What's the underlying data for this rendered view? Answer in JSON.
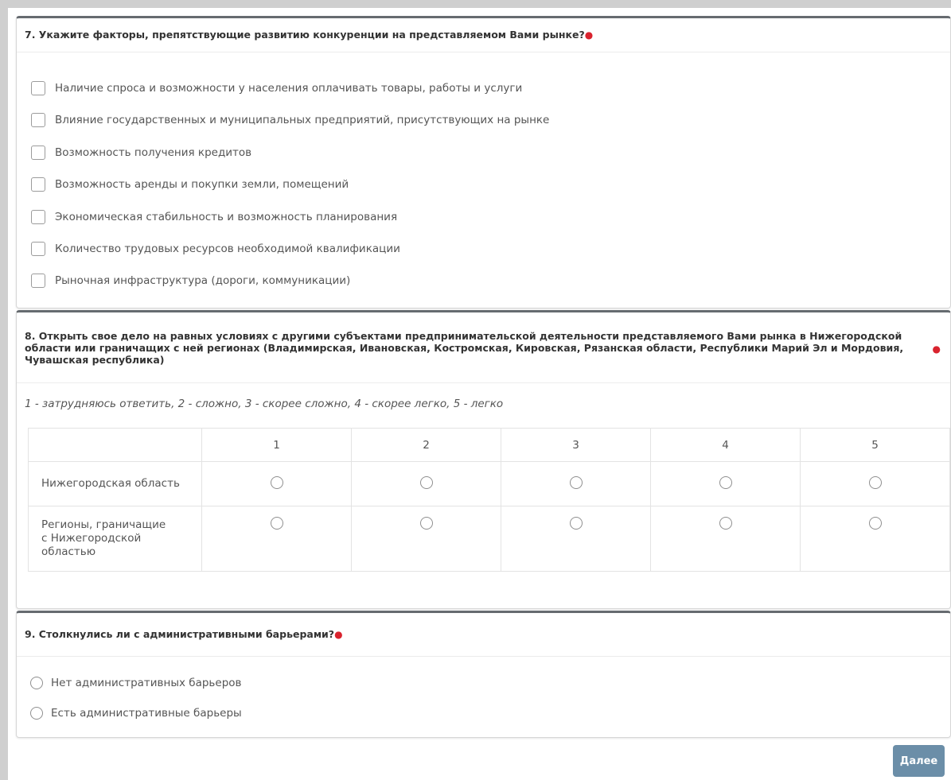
{
  "q7": {
    "title": "7. Укажите факторы, препятствующие развитию конкуренции на представляемом Вами рынке?",
    "options": [
      "Наличие спроса и возможности у населения оплачивать товары, работы и услуги",
      "Влияние государственных и муниципальных предприятий, присутствующих на рынке",
      "Возможность получения кредитов",
      "Возможность аренды и покупки земли, помещений",
      "Экономическая стабильность и возможность планирования",
      "Количество трудовых ресурсов необходимой квалификации",
      "Рыночная инфраструктура (дороги, коммуникации)"
    ]
  },
  "q8": {
    "title": "8. Открыть свое дело на равных условиях с другими субъектами предпринимательской деятельности представляемого Вами рынка в Нижегородской области или граничащих с ней регионах (Владимирская, Ивановская, Костромская, Кировская, Рязанская области, Республики Марий Эл и Мордовия, Чувашская республика)",
    "scale_hint": "1 - затрудняюсь ответить, 2 - сложно, 3 - скорее сложно, 4 - скорее легко, 5 - легко",
    "columns": [
      "1",
      "2",
      "3",
      "4",
      "5"
    ],
    "rows": [
      "Нижегородская область",
      "Регионы, граничащие с Нижегородской областью"
    ]
  },
  "q9": {
    "title": "9. Столкнулись ли с административными барьерами?",
    "options": [
      "Нет административных барьеров",
      "Есть административные барьеры"
    ]
  },
  "required_mark": "●",
  "next_button": "Далее",
  "colors": {
    "required": "#d9232e",
    "card_top_border": "#666b70",
    "button_bg": "#6b8ea8"
  }
}
